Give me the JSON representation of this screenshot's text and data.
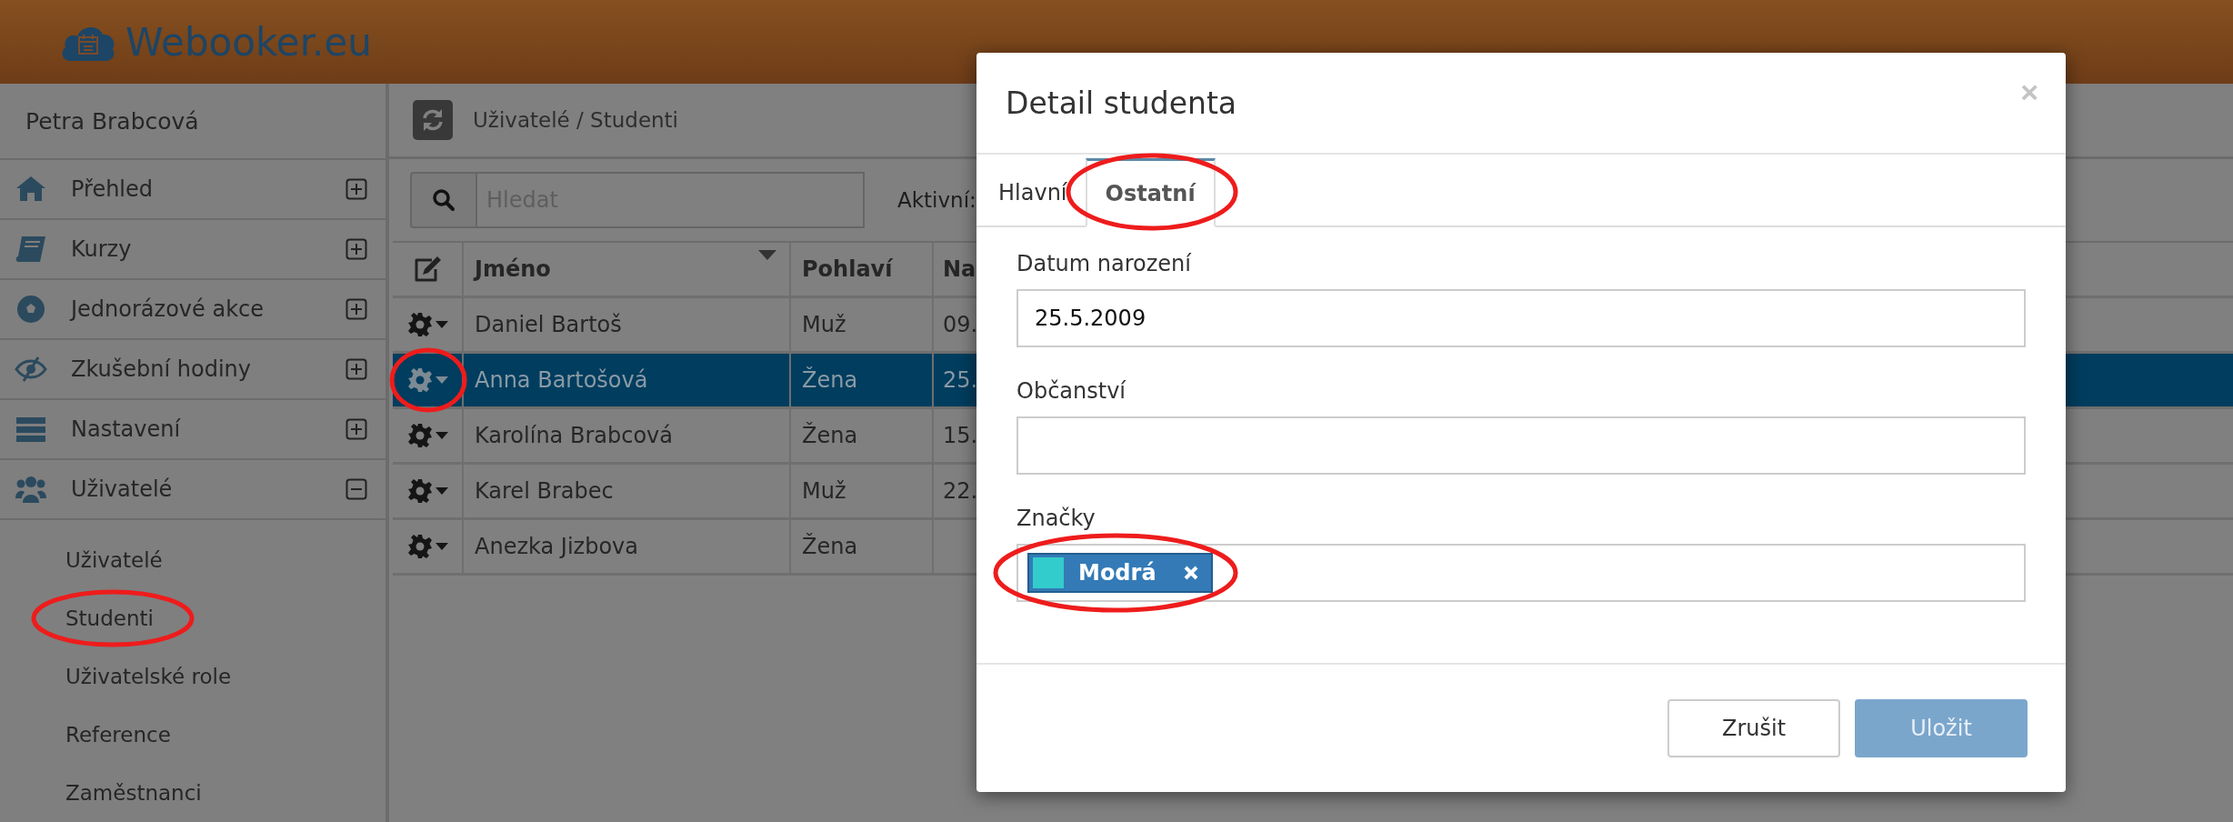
{
  "header": {
    "logo": "Webooker.eu"
  },
  "sidebar": {
    "user": "Petra Brabcová",
    "items": [
      {
        "label": "Přehled",
        "expanded": false
      },
      {
        "label": "Kurzy",
        "expanded": false
      },
      {
        "label": "Jednorázové akce",
        "expanded": false
      },
      {
        "label": "Zkušební hodiny",
        "expanded": false
      },
      {
        "label": "Nastavení",
        "expanded": false
      },
      {
        "label": "Uživatelé",
        "expanded": true,
        "children": [
          {
            "label": "Uživatelé",
            "highlighted": false
          },
          {
            "label": "Studenti",
            "highlighted": true
          },
          {
            "label": "Uživatelské role",
            "highlighted": false
          },
          {
            "label": "Reference",
            "highlighted": false
          },
          {
            "label": "Zaměstnanci",
            "highlighted": false
          }
        ]
      }
    ]
  },
  "main": {
    "breadcrumb": "Uživatelé / Studenti",
    "search": {
      "placeholder": "Hledat"
    },
    "filter_label": "Aktivní:",
    "table": {
      "columns": [
        {
          "label": "Jméno",
          "sorted": true
        },
        {
          "label": "Pohlaví",
          "sorted": false
        },
        {
          "label": "Na",
          "sorted": false
        }
      ],
      "rows": [
        {
          "name": "Daniel Bartoš",
          "gender": "Muž",
          "column_3": "09.",
          "selected": false,
          "highlighted": false
        },
        {
          "name": "Anna Bartošová",
          "gender": "Žena",
          "column_3": "25.",
          "selected": true,
          "highlighted": true
        },
        {
          "name": "Karolína Brabcová",
          "gender": "Žena",
          "column_3": "15.",
          "selected": false,
          "highlighted": false
        },
        {
          "name": "Karel Brabec",
          "gender": "Muž",
          "column_3": "22.",
          "selected": false,
          "highlighted": false
        },
        {
          "name": "Anezka Jizbova",
          "gender": "Žena",
          "selected": false,
          "highlighted": false
        }
      ]
    }
  },
  "modal": {
    "title": "Detail studenta",
    "close": "×",
    "tabs": [
      {
        "label": "Hlavní",
        "selected": false,
        "highlighted": false
      },
      {
        "label": "Ostatní",
        "selected": true,
        "highlighted": true
      }
    ],
    "fields": [
      {
        "kind": "text",
        "label": "Datum narození",
        "value": "25.5.2009"
      },
      {
        "kind": "text",
        "label": "Občanství"
      },
      {
        "kind": "tags",
        "label": "Značky",
        "tags": [
          {
            "label": "Modrá",
            "color": "#33cccc",
            "highlighted": true
          }
        ]
      }
    ],
    "buttons": [
      {
        "label": "Zrušit",
        "kind": "default",
        "disabled": false
      },
      {
        "label": "Uložit",
        "kind": "primary",
        "disabled": true
      }
    ]
  }
}
